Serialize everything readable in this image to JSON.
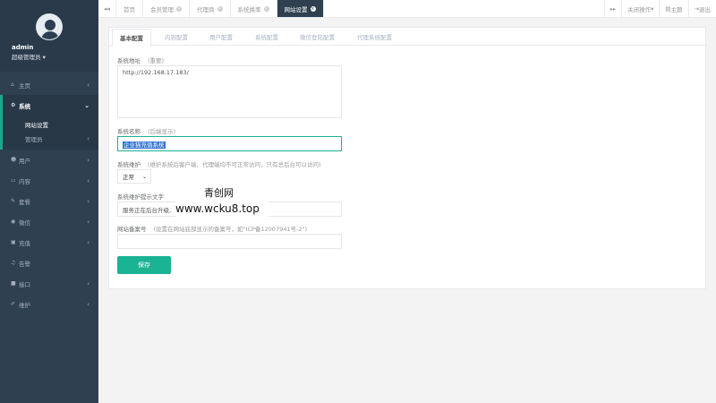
{
  "sidebar": {
    "user": {
      "name": "admin",
      "role": "超级管理员"
    },
    "items": [
      {
        "label": "主页",
        "icon": "home-icon"
      },
      {
        "label": "系统",
        "icon": "gears-icon"
      },
      {
        "label": "用户",
        "icon": "users-icon"
      },
      {
        "label": "内容",
        "icon": "inbox-icon"
      },
      {
        "label": "套餐",
        "icon": "edit-icon"
      },
      {
        "label": "微信",
        "icon": "wechat-icon"
      },
      {
        "label": "充值",
        "icon": "cart-icon"
      },
      {
        "label": "告警",
        "icon": "bell-icon"
      },
      {
        "label": "接口",
        "icon": "plug-icon"
      },
      {
        "label": "维护",
        "icon": "wrench-icon"
      }
    ],
    "subitems": [
      {
        "label": "网站设置"
      },
      {
        "label": "管理员"
      }
    ]
  },
  "topbar": {
    "tabs": [
      {
        "label": "首页"
      },
      {
        "label": "会员管理"
      },
      {
        "label": "代理商"
      },
      {
        "label": "系统换率"
      },
      {
        "label": "网站设置"
      }
    ],
    "close_ops": "关闭操作",
    "theme": "主题",
    "logout": "退出"
  },
  "panel_tabs": [
    "基本配置",
    "内容配置",
    "用户配置",
    "系统配置",
    "微信登陆配置",
    "代理系统配置"
  ],
  "form": {
    "site_url_label": "系统地址",
    "site_url_hint": "(重要)",
    "site_url_value": "http://192.168.17.183/",
    "site_name_label": "系统名称",
    "site_name_hint": "(后端显示)",
    "site_name_value": "企业猫充值系统",
    "maintenance_label": "系统维护",
    "maintenance_hint": "(维护系统后客户端、代理端均不可正常访问，只有总后台可以访问)",
    "maintenance_value": "正常",
    "maint_text_label": "系统维护提示文字",
    "maint_text_value": "服务正在后台升级,",
    "icp_label": "网站备案号",
    "icp_hint": "(设置在网站底部显示的备案号，如\"ICP备12007941号-2\")",
    "icp_value": "",
    "save_label": "保存"
  },
  "watermark": {
    "line1": "青创网",
    "line2": "www.wcku8.top"
  }
}
